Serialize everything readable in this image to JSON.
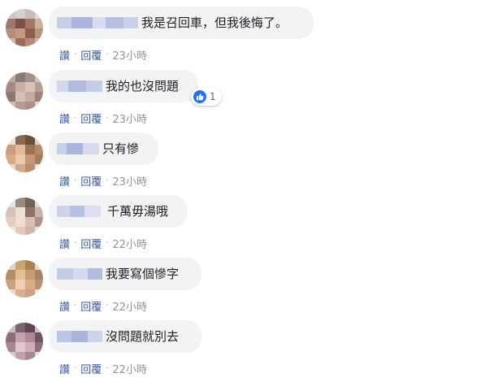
{
  "actions": {
    "like": "讚",
    "reply": "回覆",
    "dot": "·"
  },
  "comments": [
    {
      "text": "我是召回車，但我後悔了。",
      "time": "23小時"
    },
    {
      "text": "我的也沒問題",
      "time": "23小時",
      "reaction_count": "1"
    },
    {
      "text": "只有慘",
      "time": "23小時"
    },
    {
      "text": "千萬毋湯哦",
      "time": "22小時"
    },
    {
      "text": "我要寫個慘字",
      "time": "22小時"
    },
    {
      "text": "沒問題就別去",
      "time": "22小時"
    }
  ],
  "colors": {
    "bubble": "#f2f3f5",
    "link": "#385898",
    "meta": "#90949c",
    "like_blue": "#1877f2"
  },
  "icons": {
    "reaction": "like-thumbs-up-icon"
  }
}
